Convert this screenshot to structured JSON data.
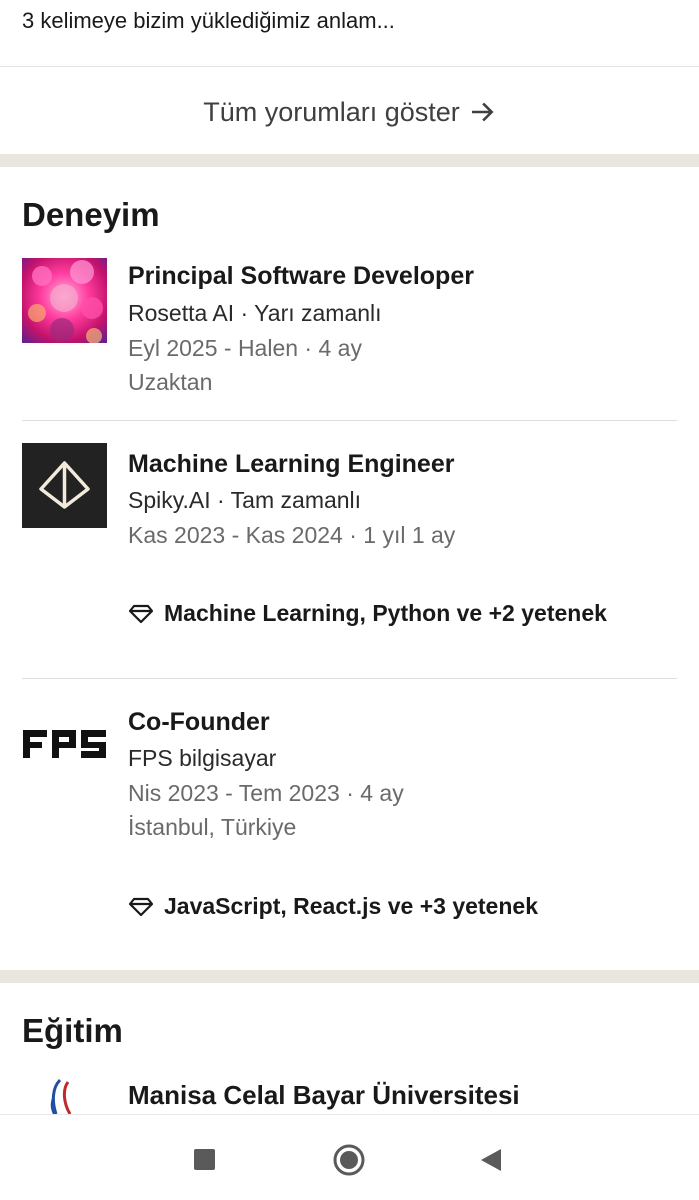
{
  "recommendation_snippet": "3 kelimeye bizim yüklediğimiz anlam...",
  "show_all_comments": {
    "label": "Tüm yorumları göster",
    "icon": "arrow-right-icon"
  },
  "experience": {
    "heading": "Deneyim",
    "items": [
      {
        "title": "Principal Software Developer",
        "company_line": "Rosetta AI · Yarı zamanlı",
        "dates": "Eyl 2025 - Halen · 4 ay",
        "location": "Uzaktan",
        "logo": "rosetta-ai-logo"
      },
      {
        "title": "Machine Learning Engineer",
        "company_line": "Spiky.AI · Tam zamanlı",
        "dates": "Kas 2023 - Kas 2024 · 1 yıl 1 ay",
        "skills": "Machine Learning, Python ve +2 yetenek",
        "logo": "spiky-ai-logo"
      },
      {
        "title": "Co-Founder",
        "company_line": "FPS bilgisayar",
        "dates": "Nis 2023 - Tem 2023 · 4 ay",
        "location": "İstanbul, Türkiye",
        "skills": "JavaScript, React.js ve +3 yetenek",
        "logo": "fps-logo"
      }
    ]
  },
  "education": {
    "heading": "Eğitim",
    "items": [
      {
        "school": "Manisa Celal Bayar Üniversitesi",
        "logo": "mcbu-logo"
      }
    ]
  },
  "system_nav": {
    "recents": "square-icon",
    "home": "circle-home-icon",
    "back": "triangle-back-icon"
  },
  "colors": {
    "section_band": "#e9e5df",
    "primary_text": "#191919",
    "secondary_text": "#6a6a6a"
  }
}
